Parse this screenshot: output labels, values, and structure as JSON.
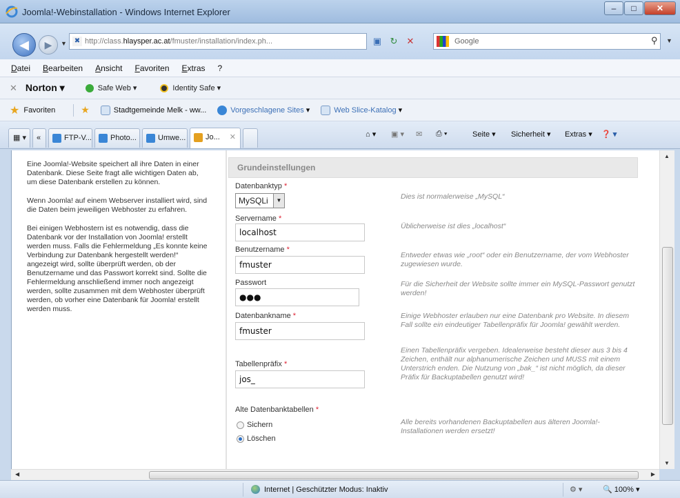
{
  "window": {
    "title": "Joomla!-Webinstallation - Windows Internet Explorer",
    "min": "–",
    "max": "□",
    "close": "✕"
  },
  "address": {
    "url_prefix": "http://class.",
    "url_host": "hlaysper.ac.at",
    "url_suffix": "/fmuster/installation/index.ph..."
  },
  "search": {
    "placeholder": "Google"
  },
  "menu": [
    "Datei",
    "Bearbeiten",
    "Ansicht",
    "Favoriten",
    "Extras",
    "?"
  ],
  "norton": {
    "brand": "Norton",
    "safe_web": "Safe Web",
    "identity_safe": "Identity Safe"
  },
  "favorites": {
    "label": "Favoriten",
    "items": [
      "Stadtgemeinde Melk - ww...",
      "Vorgeschlagene Sites",
      "Web Slice-Katalog"
    ]
  },
  "tabs": [
    "FTP-V...",
    "Photo...",
    "Umwe...",
    "Jo..."
  ],
  "commands": {
    "page": "Seite",
    "security": "Sicherheit",
    "tools": "Extras"
  },
  "left_text": [
    "Eine Joomla!-Website speichert all ihre Daten in einer Datenbank. Diese Seite fragt alle wichtigen Daten ab, um diese Datenbank erstellen zu können.",
    "Wenn Joomla! auf einem Webserver installiert wird, sind die Daten beim jeweiligen Webhoster zu erfahren.",
    "Bei einigen Webhostern ist es notwendig, dass die Datenbank vor der Installation von Joomla! erstellt werden muss. Falls die Fehlermeldung „Es konnte keine Verbindung zur Datenbank hergestellt werden!“ angezeigt wird, sollte überprüft werden, ob der Benutzername und das Passwort korrekt sind. Sollte die Fehlermeldung anschließend immer noch angezeigt werden, sollte zusammen mit dem Webhoster überprüft werden, ob vorher eine Datenbank für Joomla! erstellt werden muss."
  ],
  "form": {
    "section_title": "Grundeinstellungen",
    "db_type": {
      "label": "Datenbanktyp",
      "value": "MySQLi",
      "hint": "Dies ist normalerweise „MySQL“"
    },
    "server": {
      "label": "Servername",
      "value": "localhost",
      "hint": "Üblicherweise ist dies „localhost“"
    },
    "user": {
      "label": "Benutzername",
      "value": "fmuster",
      "hint": "Entweder etwas wie „root“ oder ein Benutzername, der vom Webhoster zugewiesen wurde."
    },
    "password": {
      "label": "Passwort",
      "value": "●●●",
      "hint": "Für die Sicherheit der Website sollte immer ein MySQL-Passwort genutzt werden!"
    },
    "db_name": {
      "label": "Datenbankname",
      "value": "fmuster",
      "hint": "Einige Webhoster erlauben nur eine Datenbank pro Website. In diesem Fall sollte ein eindeutiger Tabellenpräfix für Joomla! gewählt werden."
    },
    "prefix": {
      "label": "Tabellenpräfix",
      "value": "jos_",
      "hint": "Einen Tabellenpräfix vergeben. Idealerweise besteht dieser aus 3 bis 4 Zeichen, enthält nur alphanumerische Zeichen und MUSS mit einem Unterstrich enden. Die Nutzung von „bak_“ ist nicht möglich, da dieser Präfix für Backuptabellen genutzt wird!"
    },
    "old_tables": {
      "label": "Alte Datenbanktabellen",
      "opt_backup": "Sichern",
      "opt_delete": "Löschen",
      "selected": "Löschen",
      "hint": "Alle bereits vorhandenen Backuptabellen aus älteren Joomla!-Installationen werden ersetzt!"
    },
    "required_mark": "*"
  },
  "status": {
    "zone": "Internet | Geschützter Modus: Inaktiv",
    "zoom": "100%"
  }
}
